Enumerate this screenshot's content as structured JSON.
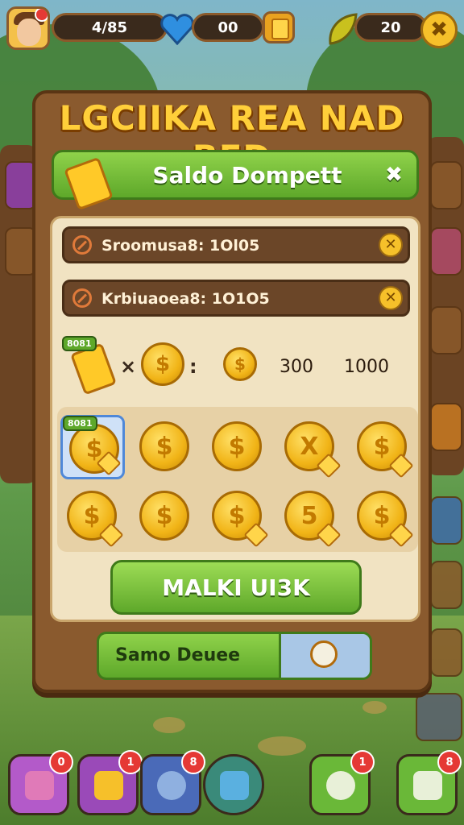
{
  "hud": {
    "coins_value": "4/85",
    "gems_value": "00",
    "leaves_value": "20",
    "close_label": "✖"
  },
  "panel": {
    "title": "LGCIIKA REA NAD BED",
    "banner_label": "Saldo Dompett",
    "banner_close": "✖",
    "fields": [
      {
        "text": "Sroomusa8: 1Ol05"
      },
      {
        "text": "Krbiuaoea8: 1O1O5"
      }
    ],
    "rate_row": {
      "tag": "8081",
      "times": "×",
      "colon": ":",
      "value_a": "300",
      "value_b": "1000"
    },
    "grid": {
      "selected_tag": "8081",
      "coin_symbols": [
        "$",
        "$",
        "$",
        "X",
        "$",
        "$",
        "$",
        "$",
        "5",
        "$"
      ]
    },
    "primary_button": "MALKI UI3K",
    "secondary_button": "Samo Deuee"
  },
  "nav": {
    "badges": [
      "0",
      "1",
      "8",
      "",
      "1",
      "8"
    ]
  },
  "colors": {
    "accent_green": "#5ea82a",
    "gold": "#ffc928",
    "wood": "#8a5a2e",
    "alert_red": "#e53935"
  }
}
